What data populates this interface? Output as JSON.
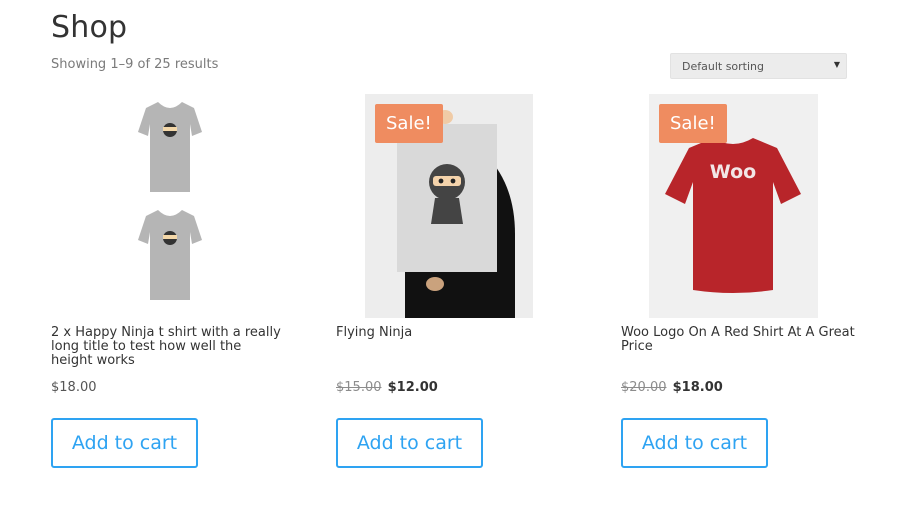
{
  "page": {
    "title": "Shop",
    "result_count": "Showing 1–9 of 25 results"
  },
  "sorting": {
    "selected": "Default sorting"
  },
  "products": [
    {
      "title": "2 x Happy Ninja t shirt with a really long title to test how well the height works",
      "price": "$18.00",
      "old_price": "",
      "sale_badge": "",
      "button": "Add to cart",
      "image": "grey-ninja-tshirts"
    },
    {
      "title": "Flying Ninja",
      "price": "$12.00",
      "old_price": "$15.00",
      "sale_badge": "Sale!",
      "button": "Add to cart",
      "image": "ninja-poster"
    },
    {
      "title": "Woo Logo On A Red Shirt At A Great Price",
      "price": "$18.00",
      "old_price": "$20.00",
      "sale_badge": "Sale!",
      "button": "Add to cart",
      "image": "red-woo-tshirt"
    }
  ],
  "colors": {
    "accent": "#2ea3f2",
    "sale": "#ef8c60",
    "shirt_red": "#b8252a",
    "shirt_grey": "#b5b5b5"
  }
}
